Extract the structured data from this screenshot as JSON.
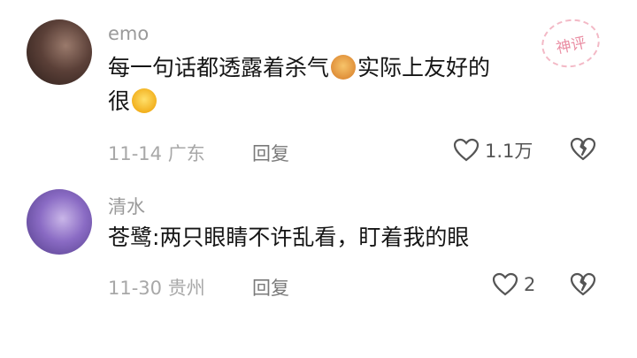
{
  "comments": [
    {
      "username": "emo",
      "text_before": "每一句话都透露着杀气",
      "emoji1": "dog-emoji",
      "text_middle": "实际上友好的",
      "text_line2": "很",
      "emoji2": "laugh-cry-emoji",
      "date": "11-14",
      "location": "广东",
      "reply_label": "回复",
      "likes": "1.1万",
      "badge": "神评"
    },
    {
      "username": "清水",
      "text": "苍鹭:两只眼睛不许乱看，盯着我的眼",
      "date": "11-30",
      "location": "贵州",
      "reply_label": "回复",
      "likes": "2"
    }
  ],
  "colors": {
    "username": "#9a9a9a",
    "meta": "#a8a8a8",
    "badge": "#ea8fa4"
  }
}
